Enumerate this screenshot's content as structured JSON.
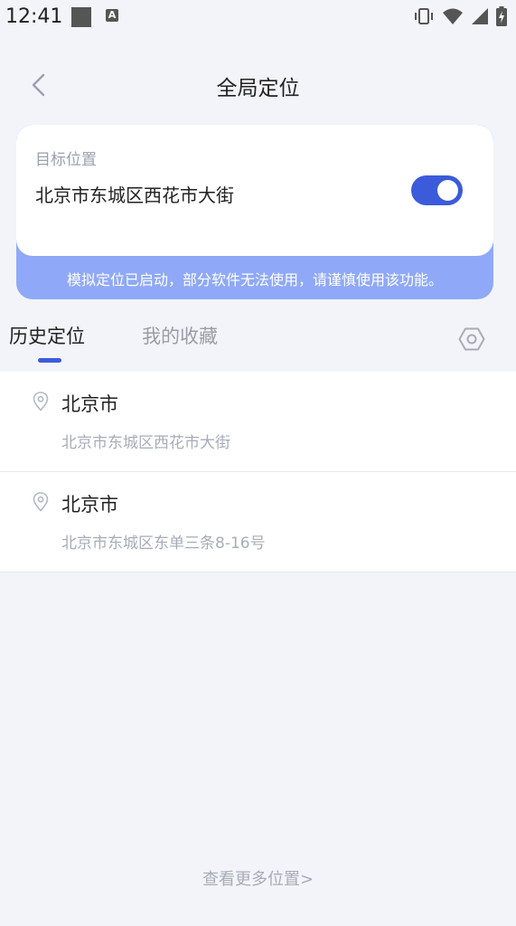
{
  "status_bar": {
    "time": "12:41",
    "icons": [
      "notification-square-icon",
      "a-badge-icon",
      "vibrate-icon",
      "wifi-icon",
      "signal-icon",
      "battery-charging-icon"
    ]
  },
  "header": {
    "title": "全局定位",
    "back_icon": "chevron-left-icon"
  },
  "target": {
    "label": "目标位置",
    "address": "北京市东城区西花市大街",
    "toggle_on": true,
    "warning": "模拟定位已启动，部分软件无法使用，请谨慎使用该功能。"
  },
  "tabs": [
    {
      "label": "历史定位",
      "active": true
    },
    {
      "label": "我的收藏",
      "active": false
    }
  ],
  "history": [
    {
      "title": "北京市",
      "subtitle": "北京市东城区西花市大街"
    },
    {
      "title": "北京市",
      "subtitle": "北京市东城区东单三条8-16号"
    }
  ],
  "more_link": "查看更多位置>",
  "colors": {
    "accent": "#3b5bdb",
    "banner": "#8fa9f8",
    "background": "#f3f4f9",
    "muted": "#a8acb8"
  }
}
